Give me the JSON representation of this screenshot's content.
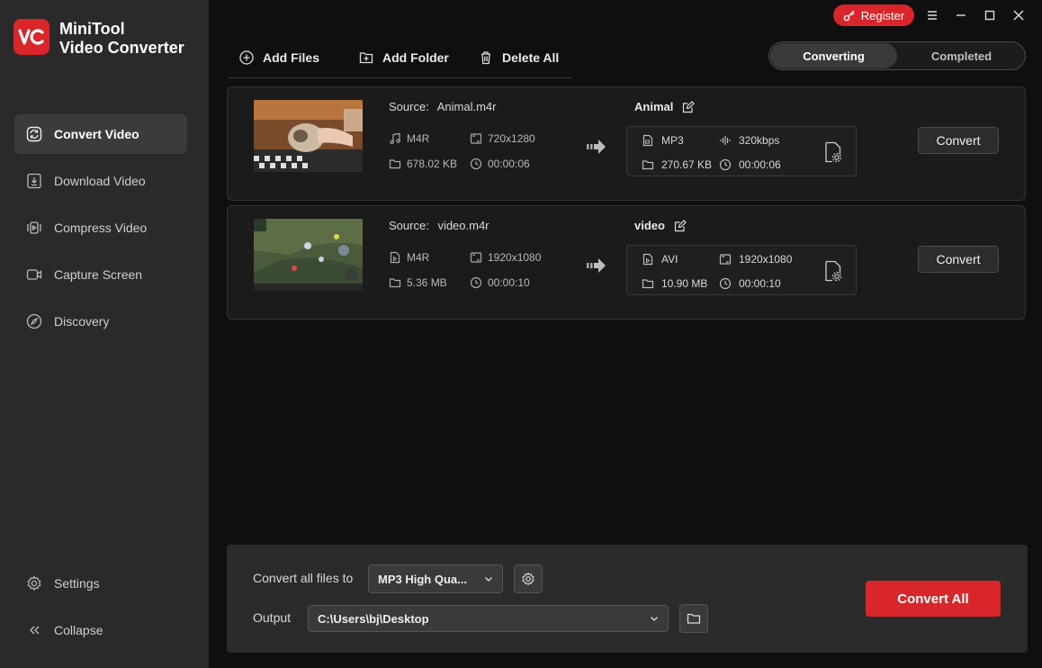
{
  "app": {
    "name_line1": "MiniTool",
    "name_line2": "Video Converter",
    "logo_text": "VC"
  },
  "sidebar": {
    "items": [
      {
        "label": "Convert Video",
        "icon": "convert-icon",
        "active": true
      },
      {
        "label": "Download Video",
        "icon": "download-icon",
        "active": false
      },
      {
        "label": "Compress Video",
        "icon": "compress-icon",
        "active": false
      },
      {
        "label": "Capture Screen",
        "icon": "camera-icon",
        "active": false
      },
      {
        "label": "Discovery",
        "icon": "compass-icon",
        "active": false
      }
    ],
    "settings_label": "Settings",
    "collapse_label": "Collapse"
  },
  "titlebar": {
    "register_label": "Register"
  },
  "toolbar": {
    "add_files": "Add Files",
    "add_folder": "Add Folder",
    "delete_all": "Delete All"
  },
  "tabs": {
    "converting": "Converting",
    "completed": "Completed",
    "active": "converting"
  },
  "files": [
    {
      "source_label": "Source:",
      "source_name": "Animal.m4r",
      "src_format": "M4R",
      "src_resolution": "720x1280",
      "src_size": "678.02 KB",
      "src_duration": "00:00:06",
      "target_name": "Animal",
      "target_format": "MP3",
      "target_quality": "320kbps",
      "target_size": "270.67 KB",
      "target_duration": "00:00:06",
      "convert_label": "Convert"
    },
    {
      "source_label": "Source:",
      "source_name": "video.m4r",
      "src_format": "M4R",
      "src_resolution": "1920x1080",
      "src_size": "5.36 MB",
      "src_duration": "00:00:10",
      "target_name": "video",
      "target_format": "AVI",
      "target_quality": "1920x1080",
      "target_size": "10.90 MB",
      "target_duration": "00:00:10",
      "convert_label": "Convert"
    }
  ],
  "bottom": {
    "convert_all_to_label": "Convert all files to",
    "format_value": "MP3 High Qua...",
    "output_label": "Output",
    "output_path": "C:\\Users\\bj\\Desktop",
    "convert_all_label": "Convert All"
  },
  "colors": {
    "accent": "#d8262a",
    "sidebar_bg": "#2a2a2a",
    "main_bg": "#0f0f0f",
    "card_bg": "#1b1b1b"
  }
}
